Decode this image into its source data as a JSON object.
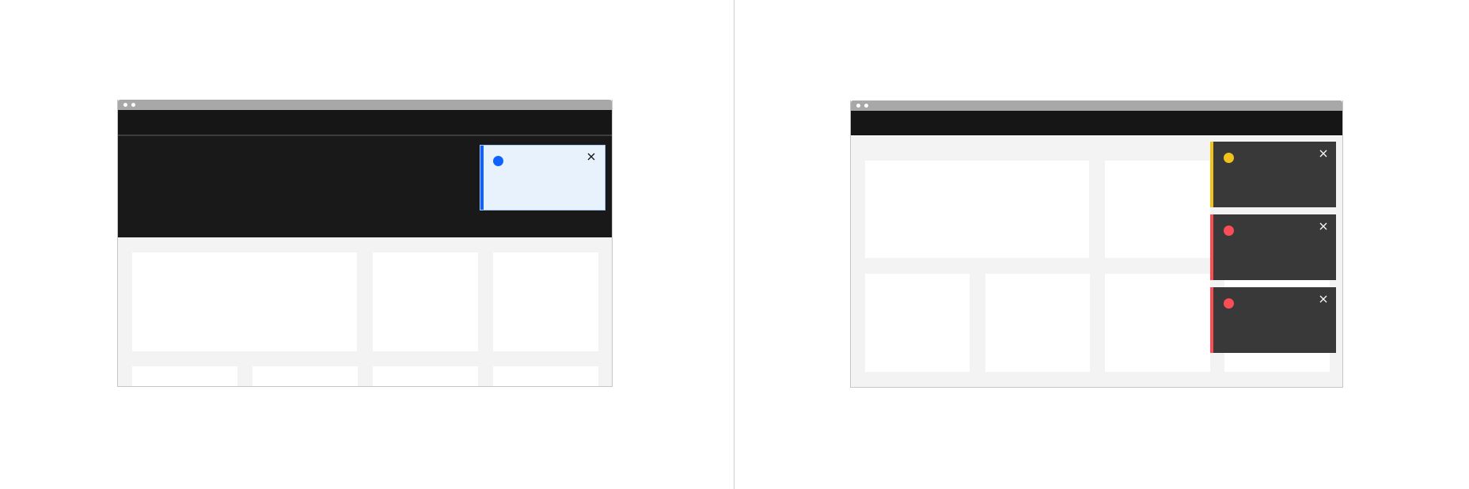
{
  "colors": {
    "page_background": "#ffffff",
    "divider": "#cfcfcf",
    "browser_chrome": "#a8a8a8",
    "navbar": "#161616",
    "hero": "#191919",
    "content_background": "#f3f3f3",
    "card": "#ffffff",
    "info_blue": "#0f62fe",
    "info_background": "#e8f2fd",
    "warning_yellow": "#f1c21b",
    "error_red": "#fa4d56",
    "dark_notification": "#393939"
  },
  "left_example": {
    "notification": {
      "kind": "info",
      "theme": "light",
      "icon": "status-dot-icon",
      "close_icon": "close-icon"
    }
  },
  "right_example": {
    "notifications": [
      {
        "kind": "warning",
        "theme": "dark",
        "icon": "status-dot-icon",
        "close_icon": "close-icon"
      },
      {
        "kind": "error",
        "theme": "dark",
        "icon": "status-dot-icon",
        "close_icon": "close-icon"
      },
      {
        "kind": "error",
        "theme": "dark",
        "icon": "status-dot-icon",
        "close_icon": "close-icon"
      }
    ]
  }
}
